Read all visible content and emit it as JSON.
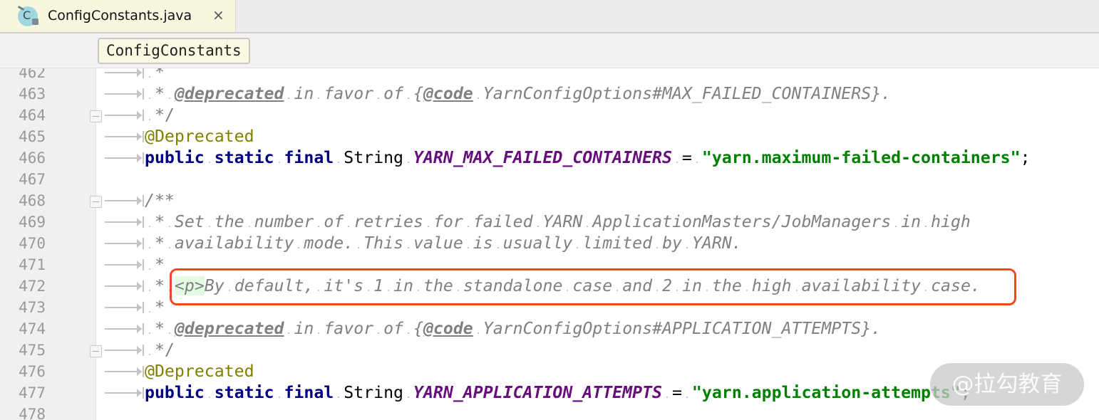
{
  "tab": {
    "label": "ConfigConstants.java",
    "icon": "java-class-locked-icon",
    "icon_letter": "C",
    "close": "×"
  },
  "breadcrumb": {
    "label": "ConfigConstants"
  },
  "colors": {
    "keyword": "#000080",
    "constant": "#660e7a",
    "string": "#008000",
    "annotation": "#808000",
    "comment": "#808080",
    "highlight_box": "#f24822"
  },
  "lines": [
    {
      "n": "462",
      "tokens": [
        {
          "t": " *",
          "c": "star"
        }
      ]
    },
    {
      "n": "463",
      "tokens": [
        {
          "t": " * ",
          "c": "star"
        },
        {
          "t": "@deprecated",
          "c": "tag"
        },
        {
          "t": " in favor of {",
          "c": "comment"
        },
        {
          "t": "@code",
          "c": "tag"
        },
        {
          "t": " YarnConfigOptions#MAX_FAILED_CONTAINERS}.",
          "c": "comment"
        }
      ]
    },
    {
      "n": "464",
      "fold": true,
      "tokens": [
        {
          "t": " */",
          "c": "star"
        }
      ]
    },
    {
      "n": "465",
      "tokens": [
        {
          "t": "@Deprecated",
          "c": "ann"
        }
      ]
    },
    {
      "n": "466",
      "tokens": [
        {
          "t": "public",
          "c": "kw"
        },
        {
          "t": " ",
          "c": "plain"
        },
        {
          "t": "static",
          "c": "kw"
        },
        {
          "t": " ",
          "c": "plain"
        },
        {
          "t": "final",
          "c": "kw"
        },
        {
          "t": " String ",
          "c": "plain"
        },
        {
          "t": "YARN_MAX_FAILED_CONTAINERS",
          "c": "const"
        },
        {
          "t": " = ",
          "c": "plain"
        },
        {
          "t": "\"yarn.maximum-failed-containers\"",
          "c": "str"
        },
        {
          "t": ";",
          "c": "plain"
        }
      ]
    },
    {
      "n": "467",
      "noarrow": true,
      "tokens": []
    },
    {
      "n": "468",
      "fold": true,
      "tokens": [
        {
          "t": "/**",
          "c": "comment"
        }
      ]
    },
    {
      "n": "469",
      "tokens": [
        {
          "t": " * ",
          "c": "star"
        },
        {
          "t": "Set the number of retries for failed YARN ApplicationMasters/JobManagers in high",
          "c": "comment"
        }
      ]
    },
    {
      "n": "470",
      "tokens": [
        {
          "t": " * ",
          "c": "star"
        },
        {
          "t": "availability mode. This value is usually limited by YARN.",
          "c": "comment"
        }
      ]
    },
    {
      "n": "471",
      "tokens": [
        {
          "t": " *",
          "c": "star"
        }
      ]
    },
    {
      "n": "472",
      "tokens": [
        {
          "t": " * ",
          "c": "star"
        },
        {
          "t": "<p>",
          "c": "html"
        },
        {
          "t": "By default, it's 1 in the standalone case and 2 in the high availability case.",
          "c": "comment"
        }
      ]
    },
    {
      "n": "473",
      "tokens": [
        {
          "t": " *",
          "c": "star"
        }
      ]
    },
    {
      "n": "474",
      "tokens": [
        {
          "t": " * ",
          "c": "star"
        },
        {
          "t": "@deprecated",
          "c": "tag"
        },
        {
          "t": " in favor of {",
          "c": "comment"
        },
        {
          "t": "@code",
          "c": "tag"
        },
        {
          "t": " YarnConfigOptions#APPLICATION_ATTEMPTS}.",
          "c": "comment"
        }
      ]
    },
    {
      "n": "475",
      "fold": true,
      "tokens": [
        {
          "t": " */",
          "c": "star"
        }
      ]
    },
    {
      "n": "476",
      "tokens": [
        {
          "t": "@Deprecated",
          "c": "ann"
        }
      ]
    },
    {
      "n": "477",
      "tokens": [
        {
          "t": "public",
          "c": "kw"
        },
        {
          "t": " ",
          "c": "plain"
        },
        {
          "t": "static",
          "c": "kw"
        },
        {
          "t": " ",
          "c": "plain"
        },
        {
          "t": "final",
          "c": "kw"
        },
        {
          "t": " String ",
          "c": "plain"
        },
        {
          "t": "YARN_APPLICATION_ATTEMPTS",
          "c": "const"
        },
        {
          "t": " = ",
          "c": "plain"
        },
        {
          "t": "\"yarn.application-attempts\"",
          "c": "str"
        },
        {
          "t": ";",
          "c": "plain"
        }
      ]
    },
    {
      "n": "478",
      "noarrow": true,
      "tokens": []
    }
  ],
  "watermark": "@拉勾教育"
}
